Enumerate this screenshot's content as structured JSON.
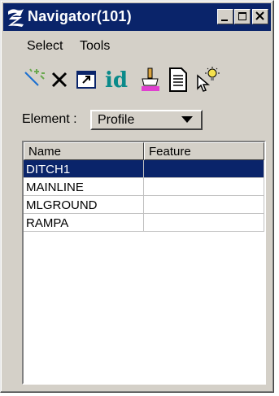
{
  "window": {
    "title": "Navigator(101)"
  },
  "menu": [
    "Select",
    "Tools"
  ],
  "toolbar": {
    "id_label": "id",
    "tools": [
      "magic-wand-icon",
      "delete-x-icon",
      "window-resize-icon",
      "id-icon",
      "paint-brush-icon",
      "document-icon",
      "lightbulb-cursor-icon"
    ]
  },
  "element": {
    "label": "Element :",
    "value": "Profile"
  },
  "list": {
    "columns": [
      "Name",
      "Feature"
    ],
    "rows": [
      {
        "name": "DITCH1",
        "feature": "",
        "selected": true
      },
      {
        "name": "MAINLINE",
        "feature": ""
      },
      {
        "name": "MLGROUND",
        "feature": ""
      },
      {
        "name": "RAMPA",
        "feature": ""
      }
    ]
  },
  "colors": {
    "titlebar": "#0a246a",
    "selection": "#0a246a",
    "face": "#d4d0c8",
    "id_teal": "#0a8a8a"
  }
}
